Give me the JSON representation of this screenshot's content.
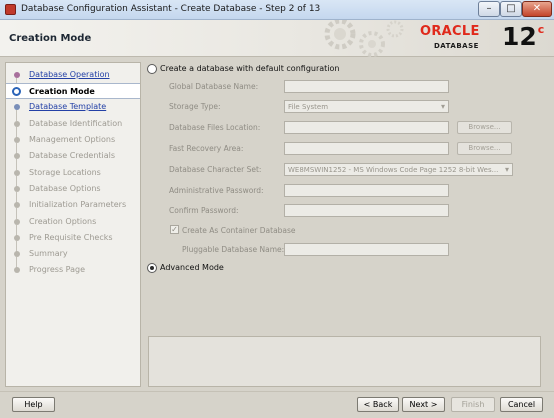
{
  "window": {
    "title": "Database Configuration Assistant - Create Database - Step 2 of 13"
  },
  "header": {
    "page_title": "Creation Mode",
    "logo_word": "ORACLE",
    "logo_sub": "DATABASE",
    "version_number": "12",
    "version_suffix": "c"
  },
  "sidebar": {
    "steps": [
      {
        "label": "Database Operation",
        "state": "done"
      },
      {
        "label": "Creation Mode",
        "state": "current"
      },
      {
        "label": "Database Template",
        "state": "link"
      },
      {
        "label": "Database Identification",
        "state": "pending"
      },
      {
        "label": "Management Options",
        "state": "pending"
      },
      {
        "label": "Database Credentials",
        "state": "pending"
      },
      {
        "label": "Storage Locations",
        "state": "pending"
      },
      {
        "label": "Database Options",
        "state": "pending"
      },
      {
        "label": "Initialization Parameters",
        "state": "pending"
      },
      {
        "label": "Creation Options",
        "state": "pending"
      },
      {
        "label": "Pre Requisite Checks",
        "state": "pending"
      },
      {
        "label": "Summary",
        "state": "pending"
      },
      {
        "label": "Progress Page",
        "state": "pending"
      }
    ]
  },
  "main": {
    "default_config_option": {
      "label": "Create a database with default configuration",
      "selected": false
    },
    "fields": {
      "global_db_name": {
        "label": "Global Database Name:",
        "value": ""
      },
      "storage_type": {
        "label": "Storage Type:",
        "value": "File System"
      },
      "db_files_location": {
        "label": "Database Files Location:",
        "value": ""
      },
      "fast_recovery_area": {
        "label": "Fast Recovery Area:",
        "value": ""
      },
      "db_character_set": {
        "label": "Database Character Set:",
        "value": "WE8MSWIN1252 - MS Windows Code Page 1252 8-bit Wes..."
      },
      "admin_password": {
        "label": "Administrative Password:",
        "value": ""
      },
      "confirm_password": {
        "label": "Confirm Password:",
        "value": ""
      },
      "pluggable_db_name": {
        "label": "Pluggable Database Name:",
        "value": ""
      }
    },
    "browse_label": "Browse...",
    "container_db_checkbox": {
      "label": "Create As Container Database",
      "checked": true,
      "mark": "✓"
    },
    "advanced_mode_option": {
      "label": "Advanced Mode",
      "selected": true
    }
  },
  "footer": {
    "help_label": "Help",
    "back_label": "< Back",
    "next_label": "Next >",
    "finish_label": "Finish",
    "cancel_label": "Cancel"
  },
  "colors": {
    "oracle_red": "#e0291b",
    "link_blue": "#2340a6",
    "current_step_ring": "#2a63b8"
  }
}
